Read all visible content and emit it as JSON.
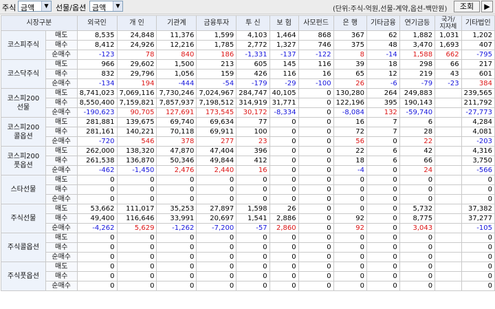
{
  "toolbar": {
    "stock_label": "주식",
    "stock_select": "금액",
    "futopt_label": "선물/옵션",
    "futopt_select": "금액",
    "unit_note": "(단위:주식-억원,선물-계약,옵션-백만원)",
    "search_button": "조회",
    "arrow_button": "▶"
  },
  "headers": [
    "시장구분",
    "외국인",
    "개 인",
    "기관계",
    "금융투자",
    "투 신",
    "보 험",
    "사모펀드",
    "은 행",
    "기타금융",
    "연기금등",
    "국가/\n지자체",
    "기타법인"
  ],
  "row_types": [
    "매도",
    "매수",
    "순매수"
  ],
  "markets": [
    {
      "name": "코스피주식",
      "rows": [
        [
          "8,535",
          "24,848",
          "11,376",
          "1,599",
          "4,103",
          "1,464",
          "868",
          "367",
          "62",
          "1,882",
          "1,031",
          "1,202"
        ],
        [
          "8,412",
          "24,926",
          "12,216",
          "1,785",
          "2,772",
          "1,327",
          "746",
          "375",
          "48",
          "3,470",
          "1,693",
          "407"
        ],
        [
          "-123",
          "78",
          "840",
          "186",
          "-1,331",
          "-137",
          "-122",
          "8",
          "-14",
          "1,588",
          "662",
          "-795"
        ]
      ]
    },
    {
      "name": "코스닥주식",
      "rows": [
        [
          "966",
          "29,602",
          "1,500",
          "213",
          "605",
          "145",
          "116",
          "39",
          "18",
          "298",
          "66",
          "217"
        ],
        [
          "832",
          "29,796",
          "1,056",
          "159",
          "426",
          "116",
          "16",
          "65",
          "12",
          "219",
          "43",
          "601"
        ],
        [
          "-134",
          "194",
          "-444",
          "-54",
          "-179",
          "-29",
          "-100",
          "26",
          "-6",
          "-79",
          "-23",
          "384"
        ]
      ]
    },
    {
      "name": "코스피200\n선물",
      "rows": [
        [
          "8,741,023",
          "7,069,116",
          "7,730,246",
          "7,024,967",
          "284,747",
          "40,105",
          "0",
          "130,280",
          "264",
          "249,883",
          "",
          "239,565"
        ],
        [
          "8,550,400",
          "7,159,821",
          "7,857,937",
          "7,198,512",
          "314,919",
          "31,771",
          "0",
          "122,196",
          "395",
          "190,143",
          "",
          "211,792"
        ],
        [
          "-190,623",
          "90,705",
          "127,691",
          "173,545",
          "30,172",
          "-8,334",
          "0",
          "-8,084",
          "132",
          "-59,740",
          "",
          "-27,773"
        ]
      ]
    },
    {
      "name": "코스피200\n콜옵션",
      "rows": [
        [
          "281,881",
          "139,675",
          "69,740",
          "69,634",
          "77",
          "0",
          "0",
          "16",
          "7",
          "6",
          "",
          "4,284"
        ],
        [
          "281,161",
          "140,221",
          "70,118",
          "69,911",
          "100",
          "0",
          "0",
          "72",
          "7",
          "28",
          "",
          "4,081"
        ],
        [
          "-720",
          "546",
          "378",
          "277",
          "23",
          "0",
          "0",
          "56",
          "0",
          "22",
          "",
          "-203"
        ]
      ]
    },
    {
      "name": "코스피200\n풋옵션",
      "rows": [
        [
          "262,000",
          "138,320",
          "47,870",
          "47,404",
          "396",
          "0",
          "0",
          "22",
          "6",
          "42",
          "",
          "4,316"
        ],
        [
          "261,538",
          "136,870",
          "50,346",
          "49,844",
          "412",
          "0",
          "0",
          "18",
          "6",
          "66",
          "",
          "3,750"
        ],
        [
          "-462",
          "-1,450",
          "2,476",
          "2,440",
          "16",
          "0",
          "0",
          "-4",
          "0",
          "24",
          "",
          "-566"
        ]
      ]
    },
    {
      "name": "스타선물",
      "rows": [
        [
          "0",
          "0",
          "0",
          "0",
          "0",
          "0",
          "0",
          "0",
          "0",
          "0",
          "",
          "0"
        ],
        [
          "0",
          "0",
          "0",
          "0",
          "0",
          "0",
          "0",
          "0",
          "0",
          "0",
          "",
          "0"
        ],
        [
          "0",
          "0",
          "0",
          "0",
          "0",
          "0",
          "0",
          "0",
          "0",
          "0",
          "",
          "0"
        ]
      ]
    },
    {
      "name": "주식선물",
      "rows": [
        [
          "53,662",
          "111,017",
          "35,253",
          "27,897",
          "1,598",
          "26",
          "0",
          "0",
          "0",
          "5,732",
          "",
          "37,382"
        ],
        [
          "49,400",
          "116,646",
          "33,991",
          "20,697",
          "1,541",
          "2,886",
          "0",
          "92",
          "0",
          "8,775",
          "",
          "37,277"
        ],
        [
          "-4,262",
          "5,629",
          "-1,262",
          "-7,200",
          "-57",
          "2,860",
          "0",
          "92",
          "0",
          "3,043",
          "",
          "-105"
        ]
      ]
    },
    {
      "name": "주식콜옵션",
      "rows": [
        [
          "0",
          "0",
          "0",
          "0",
          "0",
          "0",
          "0",
          "0",
          "0",
          "0",
          "",
          "0"
        ],
        [
          "0",
          "0",
          "0",
          "0",
          "0",
          "0",
          "0",
          "0",
          "0",
          "0",
          "",
          "0"
        ],
        [
          "0",
          "0",
          "0",
          "0",
          "0",
          "0",
          "0",
          "0",
          "0",
          "0",
          "",
          "0"
        ]
      ]
    },
    {
      "name": "주식풋옵션",
      "rows": [
        [
          "0",
          "0",
          "0",
          "0",
          "0",
          "0",
          "0",
          "0",
          "0",
          "0",
          "",
          "0"
        ],
        [
          "0",
          "0",
          "0",
          "0",
          "0",
          "0",
          "0",
          "0",
          "0",
          "0",
          "",
          "0"
        ],
        [
          "0",
          "0",
          "0",
          "0",
          "0",
          "0",
          "0",
          "0",
          "0",
          "0",
          "",
          "0"
        ]
      ]
    }
  ],
  "colors": {
    "negative": "#1414dc",
    "positive": "#dc1414",
    "header_bg": "#e9eef8"
  }
}
